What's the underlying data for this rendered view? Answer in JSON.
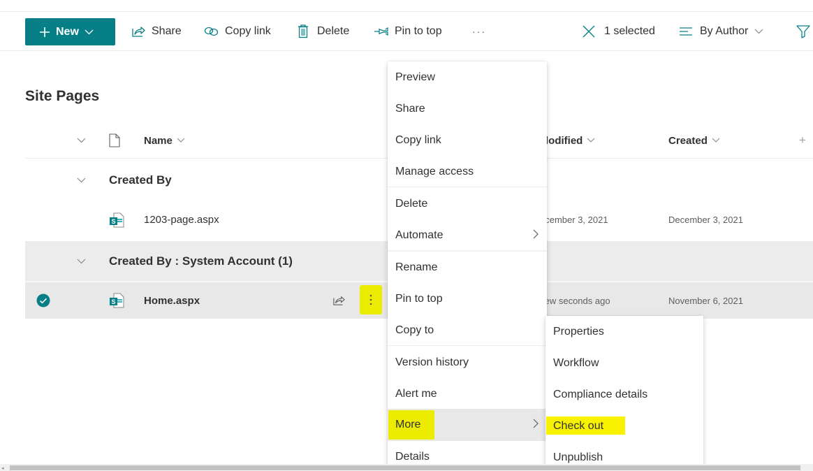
{
  "command_bar": {
    "new_label": "New",
    "share_label": "Share",
    "copy_link_label": "Copy link",
    "delete_label": "Delete",
    "pin_label": "Pin to top",
    "overflow_label": "···",
    "selected_label": "1 selected",
    "view_label": "By Author",
    "accent": "#077f86"
  },
  "page": {
    "title": "Site Pages"
  },
  "list": {
    "columns": {
      "name": "Name",
      "modified": "Modified",
      "modified_visible": "lodified",
      "created": "Created",
      "add_column": "+"
    },
    "groups": [
      {
        "title": "Created By",
        "items": [
          {
            "name": "1203-page.aspx",
            "modified": "December 3, 2021",
            "modified_visible": "ecember 3, 2021",
            "created": "December 3, 2021",
            "selected": false
          }
        ]
      },
      {
        "title": "Created By : System Account (1)",
        "items": [
          {
            "name": "Home.aspx",
            "modified": "A few seconds ago",
            "modified_visible": "few seconds ago",
            "created": "November 6, 2021",
            "selected": true
          }
        ]
      }
    ]
  },
  "context_menu": {
    "items": [
      {
        "label": "Preview"
      },
      {
        "label": "Share"
      },
      {
        "label": "Copy link"
      },
      {
        "label": "Manage access"
      },
      {
        "label": "Delete"
      },
      {
        "label": "Automate",
        "submenu": true
      },
      {
        "label": "Rename"
      },
      {
        "label": "Pin to top"
      },
      {
        "label": "Copy to"
      },
      {
        "label": "Version history"
      },
      {
        "label": "Alert me"
      },
      {
        "label": "More",
        "submenu": true,
        "active": true
      },
      {
        "label": "Details"
      }
    ]
  },
  "submenu": {
    "items": [
      {
        "label": "Properties"
      },
      {
        "label": "Workflow"
      },
      {
        "label": "Compliance details"
      },
      {
        "label": "Check out",
        "highlighted": true
      },
      {
        "label": "Unpublish"
      }
    ]
  },
  "highlight_color": "#f0f000"
}
